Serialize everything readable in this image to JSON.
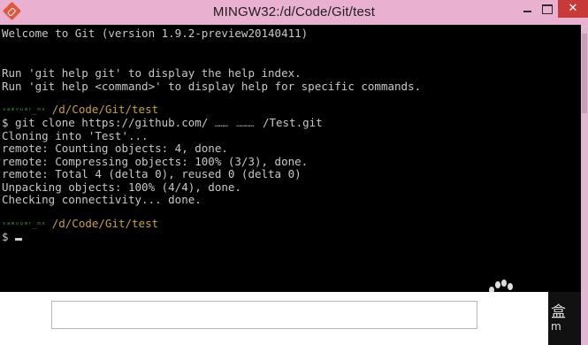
{
  "window": {
    "title": "MINGW32:/d/Code/Git/test",
    "close_glyph": "✕",
    "icons": [
      "git-icon",
      "minimize-icon",
      "maximize-icon",
      "close-icon"
    ]
  },
  "terminal": {
    "background": "#000000",
    "text_color": "#c8c8c8",
    "prompt_path_color": "#c8a03a",
    "lines": {
      "l0": "Welcome to Git (version 1.9.2-preview20140411)",
      "l3": "Run 'git help git' to display the help index.",
      "l4": "Run 'git help <command>' to display help for specific commands.",
      "l6_user": "ˢᵃᵐᵛᵘᵐʳ_ᵐˣ",
      "l6_path": " /d/Code/Git/test",
      "l7_pre": "$ git clone https://github.com/ ",
      "l7_blur": "………  …………  ",
      "l7_post": "/Test.git",
      "l8": "Cloning into 'Test'...",
      "l9": "remote: Counting objects: 4, done.",
      "l10": "remote: Compressing objects: 100% (3/3), done.",
      "l11": "remote: Total 4 (delta 0), reused 0 (delta 0)",
      "l12": "Unpacking objects: 100% (4/4), done.",
      "l13": "Checking connectivity... done.",
      "l15_user": "ˢᵃᵐᵛᵘᵐʳ_ᵐˣ",
      "l15_path": " /d/Code/Git/test",
      "l16": "$ "
    }
  },
  "overlay": {
    "side_glyph": "盒",
    "side_glyph2": "m"
  }
}
